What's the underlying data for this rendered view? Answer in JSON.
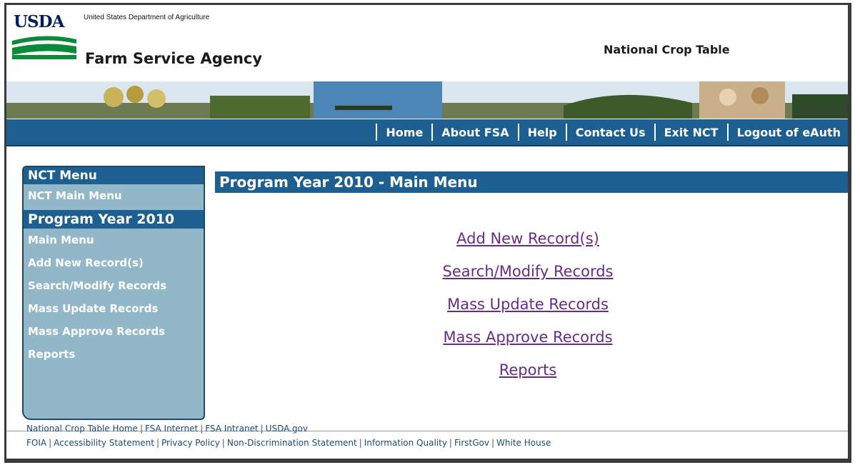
{
  "header": {
    "logo_text": "USDA",
    "department": "United States Department of Agriculture",
    "agency": "Farm Service Agency",
    "app_title": "National Crop Table"
  },
  "nav": {
    "items": [
      "Home",
      "About FSA",
      "Help",
      "Contact Us",
      "Exit NCT",
      "Logout of eAuth"
    ]
  },
  "sidebar": {
    "menu_title": "NCT Menu",
    "main_menu_link": "NCT Main Menu",
    "year_header": "Program Year 2010",
    "items": [
      "Main Menu",
      "Add New Record(s)",
      "Search/Modify Records",
      "Mass Update Records",
      "Mass Approve Records",
      "Reports"
    ]
  },
  "main": {
    "title": "Program Year 2010 - Main Menu",
    "links": [
      "Add New Record(s)",
      "Search/Modify Records",
      "Mass Update Records",
      "Mass Approve Records",
      "Reports"
    ]
  },
  "footer": {
    "row1": [
      "National Crop Table Home",
      "FSA Internet",
      "FSA Intranet",
      "USDA.gov"
    ],
    "row2": [
      "FOIA",
      "Accessibility Statement",
      "Privacy Policy",
      "Non-Discrimination Statement",
      "Information Quality",
      "FirstGov",
      "White House"
    ]
  },
  "colors": {
    "nav_blue": "#1c5f90",
    "sidebar_bg": "#91b7c9",
    "link_purple": "#6a2b88"
  }
}
